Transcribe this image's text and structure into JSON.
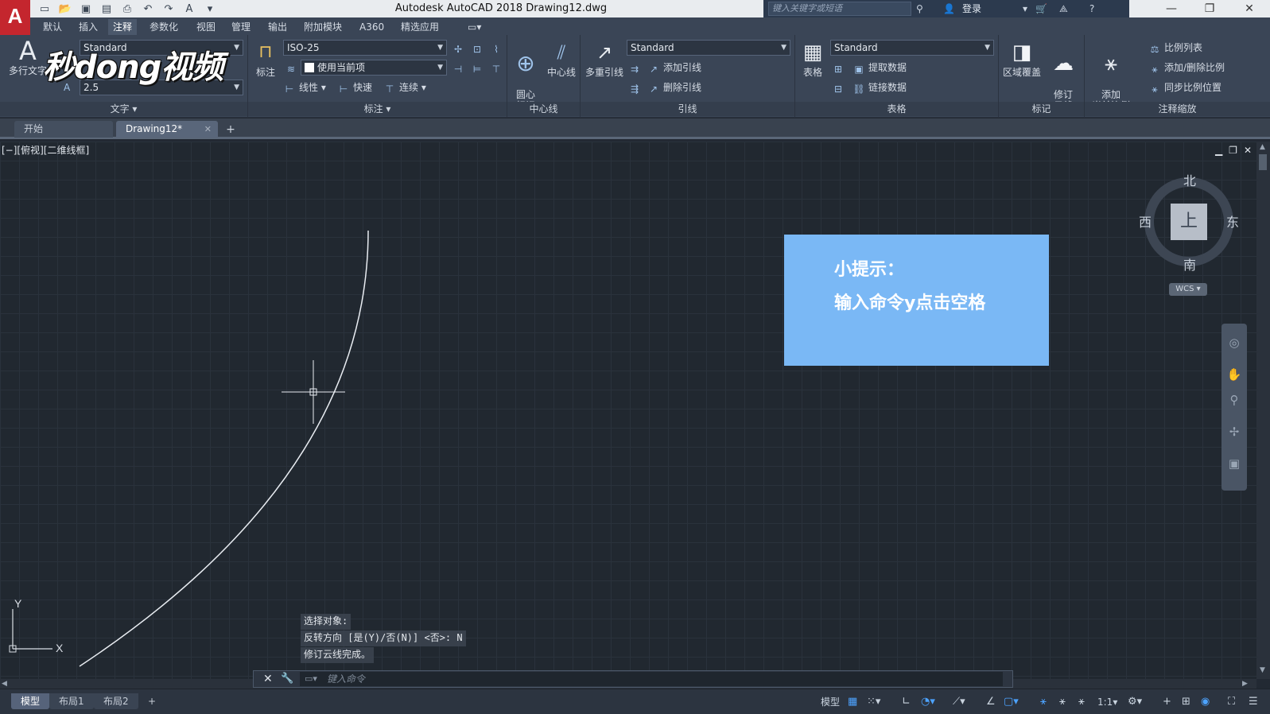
{
  "app": {
    "logo_letter": "A",
    "window_title": "Autodesk AutoCAD 2018    Drawing12.dwg",
    "search_placeholder": "键入关键字或短语",
    "login_label": "登录"
  },
  "ribbon_tabs": [
    "默认",
    "插入",
    "注释",
    "参数化",
    "视图",
    "管理",
    "输出",
    "附加模块",
    "A360",
    "精选应用"
  ],
  "active_ribbon_tab": "注释",
  "ribbon": {
    "text_panel": {
      "title": "文字",
      "multiline_text_label": "多行文字",
      "text_style": "Standard",
      "text_height": "2.5"
    },
    "dimension_panel": {
      "title": "标注",
      "dimension_label": "标注",
      "dim_style": "ISO-25",
      "layer_value": "使用当前项",
      "linear_label": "线性",
      "quick_label": "快速",
      "continue_label": "连续"
    },
    "centerline_panel": {
      "title": "中心线",
      "center_mark_label": "圆心\n标记",
      "centerline_label": "中心线"
    },
    "leader_panel": {
      "title": "引线",
      "multileader_label": "多重引线",
      "leader_style": "Standard",
      "add_leader_label": "添加引线",
      "remove_leader_label": "删除引线"
    },
    "table_panel": {
      "title": "表格",
      "table_label": "表格",
      "table_style": "Standard",
      "extract_data_label": "提取数据",
      "link_data_label": "链接数据"
    },
    "markup_panel": {
      "title": "标记",
      "wipeout_label": "区域覆盖",
      "revcloud_label": "修订\n云线"
    },
    "annotation_scaling_panel": {
      "title": "注释缩放",
      "add_scale_label": "添加\n当前比例",
      "scale_list_label": "比例列表",
      "add_delete_scales_label": "添加/删除比例",
      "sync_scale_label": "同步比例位置"
    }
  },
  "watermark": "秒dong视频",
  "doc_tabs": [
    {
      "label": "开始"
    },
    {
      "label": "Drawing12*"
    }
  ],
  "viewport_label": "[−][俯视][二维线框]",
  "tip": {
    "title": "小提示：",
    "body": "输入命令y点击空格"
  },
  "viewcube": {
    "north": "北",
    "south": "南",
    "east": "东",
    "west": "西",
    "face": "上",
    "wcs": "WCS"
  },
  "ucs": {
    "y": "Y",
    "x": "X"
  },
  "command_history": [
    "选择对象:",
    "反转方向 [是(Y)/否(N)] <否>: N",
    "修订云线完成。"
  ],
  "command_placeholder": "键入命令",
  "layout_tabs": [
    "模型",
    "布局1",
    "布局2"
  ],
  "status": {
    "model_label": "模型",
    "scale_label": "1:1"
  },
  "colors": {
    "tip_background": "#7ab8f5",
    "canvas_background": "#212830",
    "accent_blue": "#4da3ff",
    "logo_red": "#c4262e"
  }
}
